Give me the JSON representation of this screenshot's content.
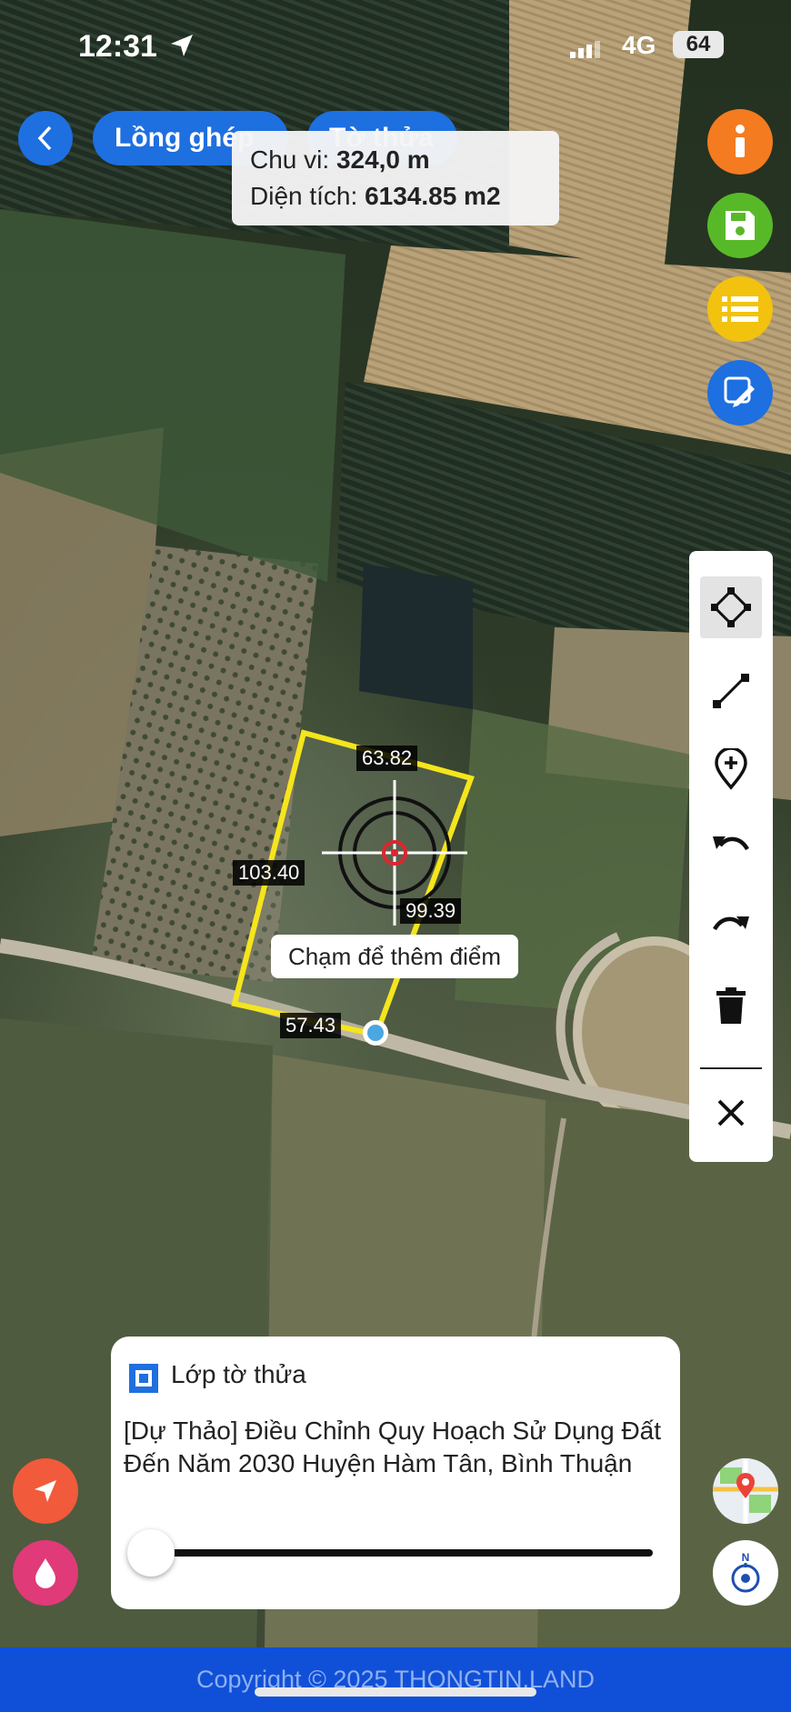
{
  "status_bar": {
    "time": "12:31",
    "network": "4G",
    "battery": "64"
  },
  "top_bar": {
    "tab_overlay": "Lồng ghép",
    "tab_parcel": "Tờ thửa"
  },
  "measurement": {
    "perimeter_label": "Chu vi:",
    "perimeter_value": "324,0 m",
    "area_label": "Diện tích:",
    "area_value": "6134.85 m2"
  },
  "right_buttons": [
    {
      "name": "info-icon",
      "color": "#f47b20"
    },
    {
      "name": "save-icon",
      "color": "#58b928"
    },
    {
      "name": "list-icon",
      "color": "#f2c20f"
    },
    {
      "name": "edit-icon",
      "color": "#1e6fe0"
    }
  ],
  "draw_tools": [
    "polygon-icon",
    "line-icon",
    "add-point-icon",
    "undo-icon",
    "redo-icon",
    "delete-icon",
    "close-icon"
  ],
  "parcel": {
    "edges": [
      "63.82",
      "103.40",
      "99.39",
      "57.43"
    ],
    "outline_color": "#f5e51c"
  },
  "hint": "Chạm để thêm điểm",
  "layer_panel": {
    "title": "Lớp tờ thửa",
    "checked": true,
    "description": "[Dự Thảo] Điều Chỉnh Quy Hoạch Sử Dụng Đất Đến Năm 2030 Huyện Hàm Tân, Bình Thuận",
    "opacity": 0
  },
  "left_buttons": [
    {
      "name": "locate-icon",
      "color": "#f15a3a"
    },
    {
      "name": "water-drop-icon",
      "color": "#e03a78"
    }
  ],
  "compass_label": "N",
  "footer": {
    "copyright": "Copyright © 2025 THONGTIN.LAND"
  }
}
